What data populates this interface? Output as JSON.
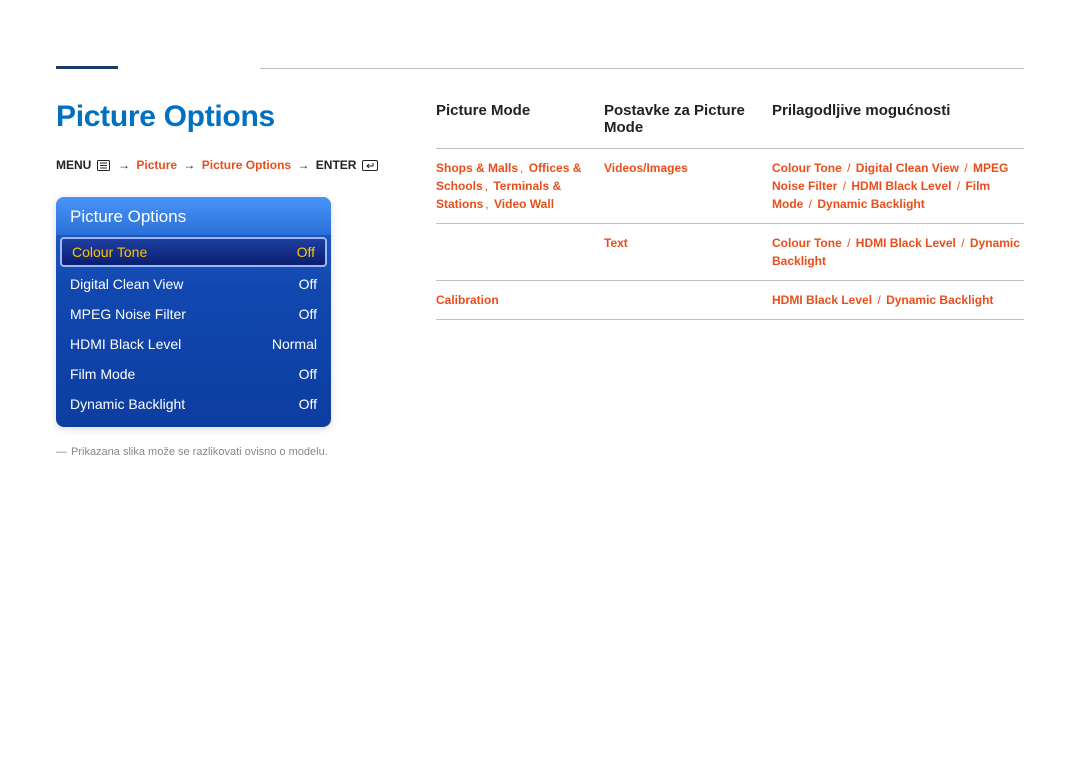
{
  "page_title": "Picture Options",
  "breadcrumb": {
    "menu": "MENU",
    "arrow": "→",
    "path1": "Picture",
    "path2": "Picture Options",
    "enter": "ENTER"
  },
  "osd": {
    "header": "Picture Options",
    "items": [
      {
        "label": "Colour Tone",
        "value": "Off",
        "selected": true
      },
      {
        "label": "Digital Clean View",
        "value": "Off",
        "selected": false
      },
      {
        "label": "MPEG Noise Filter",
        "value": "Off",
        "selected": false
      },
      {
        "label": "HDMI Black Level",
        "value": "Normal",
        "selected": false
      },
      {
        "label": "Film Mode",
        "value": "Off",
        "selected": false
      },
      {
        "label": "Dynamic Backlight",
        "value": "Off",
        "selected": false
      }
    ]
  },
  "note": "Prikazana slika može se razlikovati ovisno o modelu.",
  "table": {
    "head": {
      "c1": "Picture Mode",
      "c2": "Postavke za Picture Mode",
      "c3": "Prilagodljive mogućnosti"
    },
    "rows": [
      {
        "c1": [
          "Shops & Malls",
          "Offices & Schools",
          "Terminals & Stations",
          "Video Wall"
        ],
        "c2": "Videos/Images",
        "c3": [
          "Colour Tone",
          "Digital Clean View",
          "MPEG Noise Filter",
          "HDMI Black Level",
          "Film Mode",
          "Dynamic Backlight"
        ]
      },
      {
        "c1": [],
        "c2": "Text",
        "c3": [
          "Colour Tone",
          "HDMI Black Level",
          "Dynamic Backlight"
        ]
      },
      {
        "c1": [
          "Calibration"
        ],
        "c2": "",
        "c3": [
          "HDMI Black Level",
          "Dynamic Backlight"
        ]
      }
    ]
  }
}
